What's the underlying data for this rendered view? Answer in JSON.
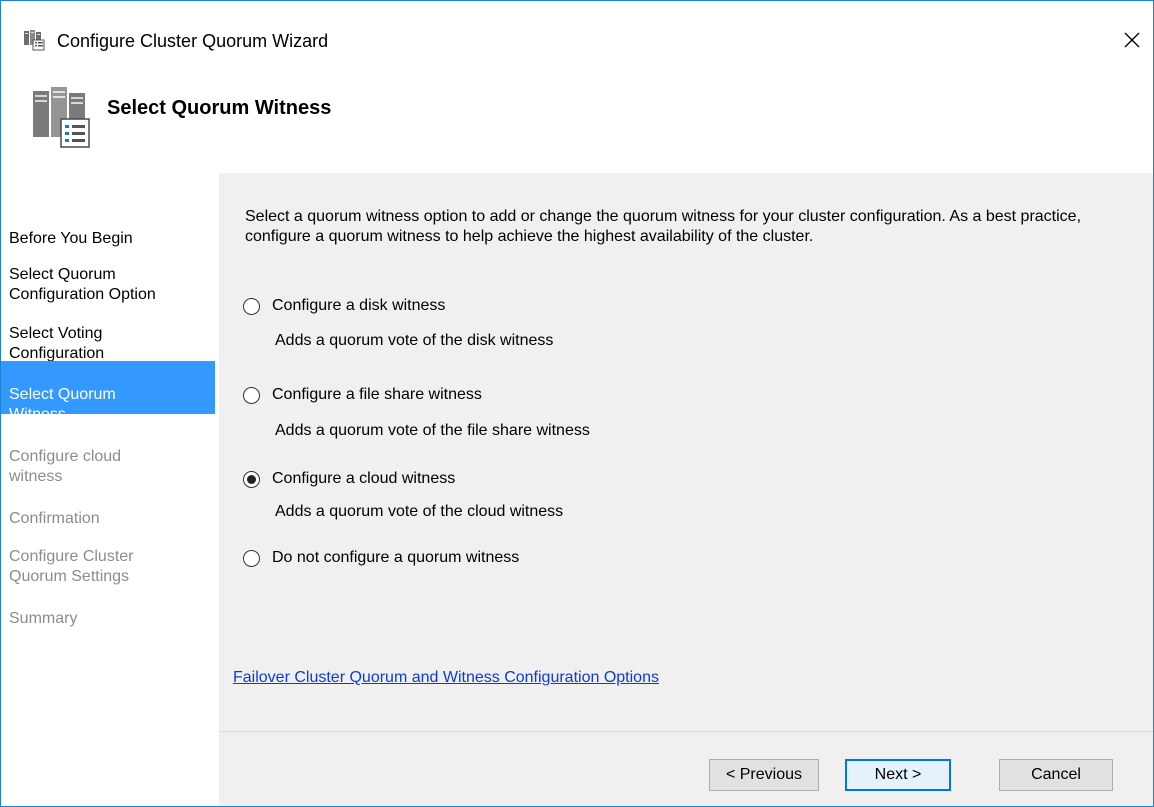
{
  "window": {
    "title": "Configure Cluster Quorum Wizard",
    "accent": "#1883d7"
  },
  "header": {
    "title": "Select Quorum Witness"
  },
  "sidebar": {
    "items": [
      {
        "label": "Before You Begin",
        "state": "normal"
      },
      {
        "label": "Select Quorum\nConfiguration Option",
        "state": "normal"
      },
      {
        "label": "Select Voting\nConfiguration",
        "state": "normal"
      },
      {
        "label": "Select Quorum\nWitness",
        "state": "active"
      },
      {
        "label": "Configure cloud\nwitness",
        "state": "disabled"
      },
      {
        "label": "Confirmation",
        "state": "disabled"
      },
      {
        "label": "Configure Cluster\nQuorum Settings",
        "state": "disabled"
      },
      {
        "label": "Summary",
        "state": "disabled"
      }
    ]
  },
  "main": {
    "description": "Select a quorum witness option to add or change the quorum witness for your cluster configuration. As a best practice, configure a quorum witness to help achieve the highest availability of the cluster.",
    "options": [
      {
        "label": "Configure a disk witness",
        "description": "Adds a quorum vote of the disk witness",
        "selected": false
      },
      {
        "label": "Configure a file share witness",
        "description": "Adds a quorum vote of the file share witness",
        "selected": false
      },
      {
        "label": "Configure a cloud witness",
        "description": "Adds a quorum vote of the cloud witness",
        "selected": true
      },
      {
        "label": "Do not configure a quorum witness",
        "description": "",
        "selected": false
      }
    ],
    "help_link": "Failover Cluster Quorum and Witness Configuration Options"
  },
  "buttons": {
    "previous": "< Previous",
    "next": "Next >",
    "cancel": "Cancel"
  }
}
